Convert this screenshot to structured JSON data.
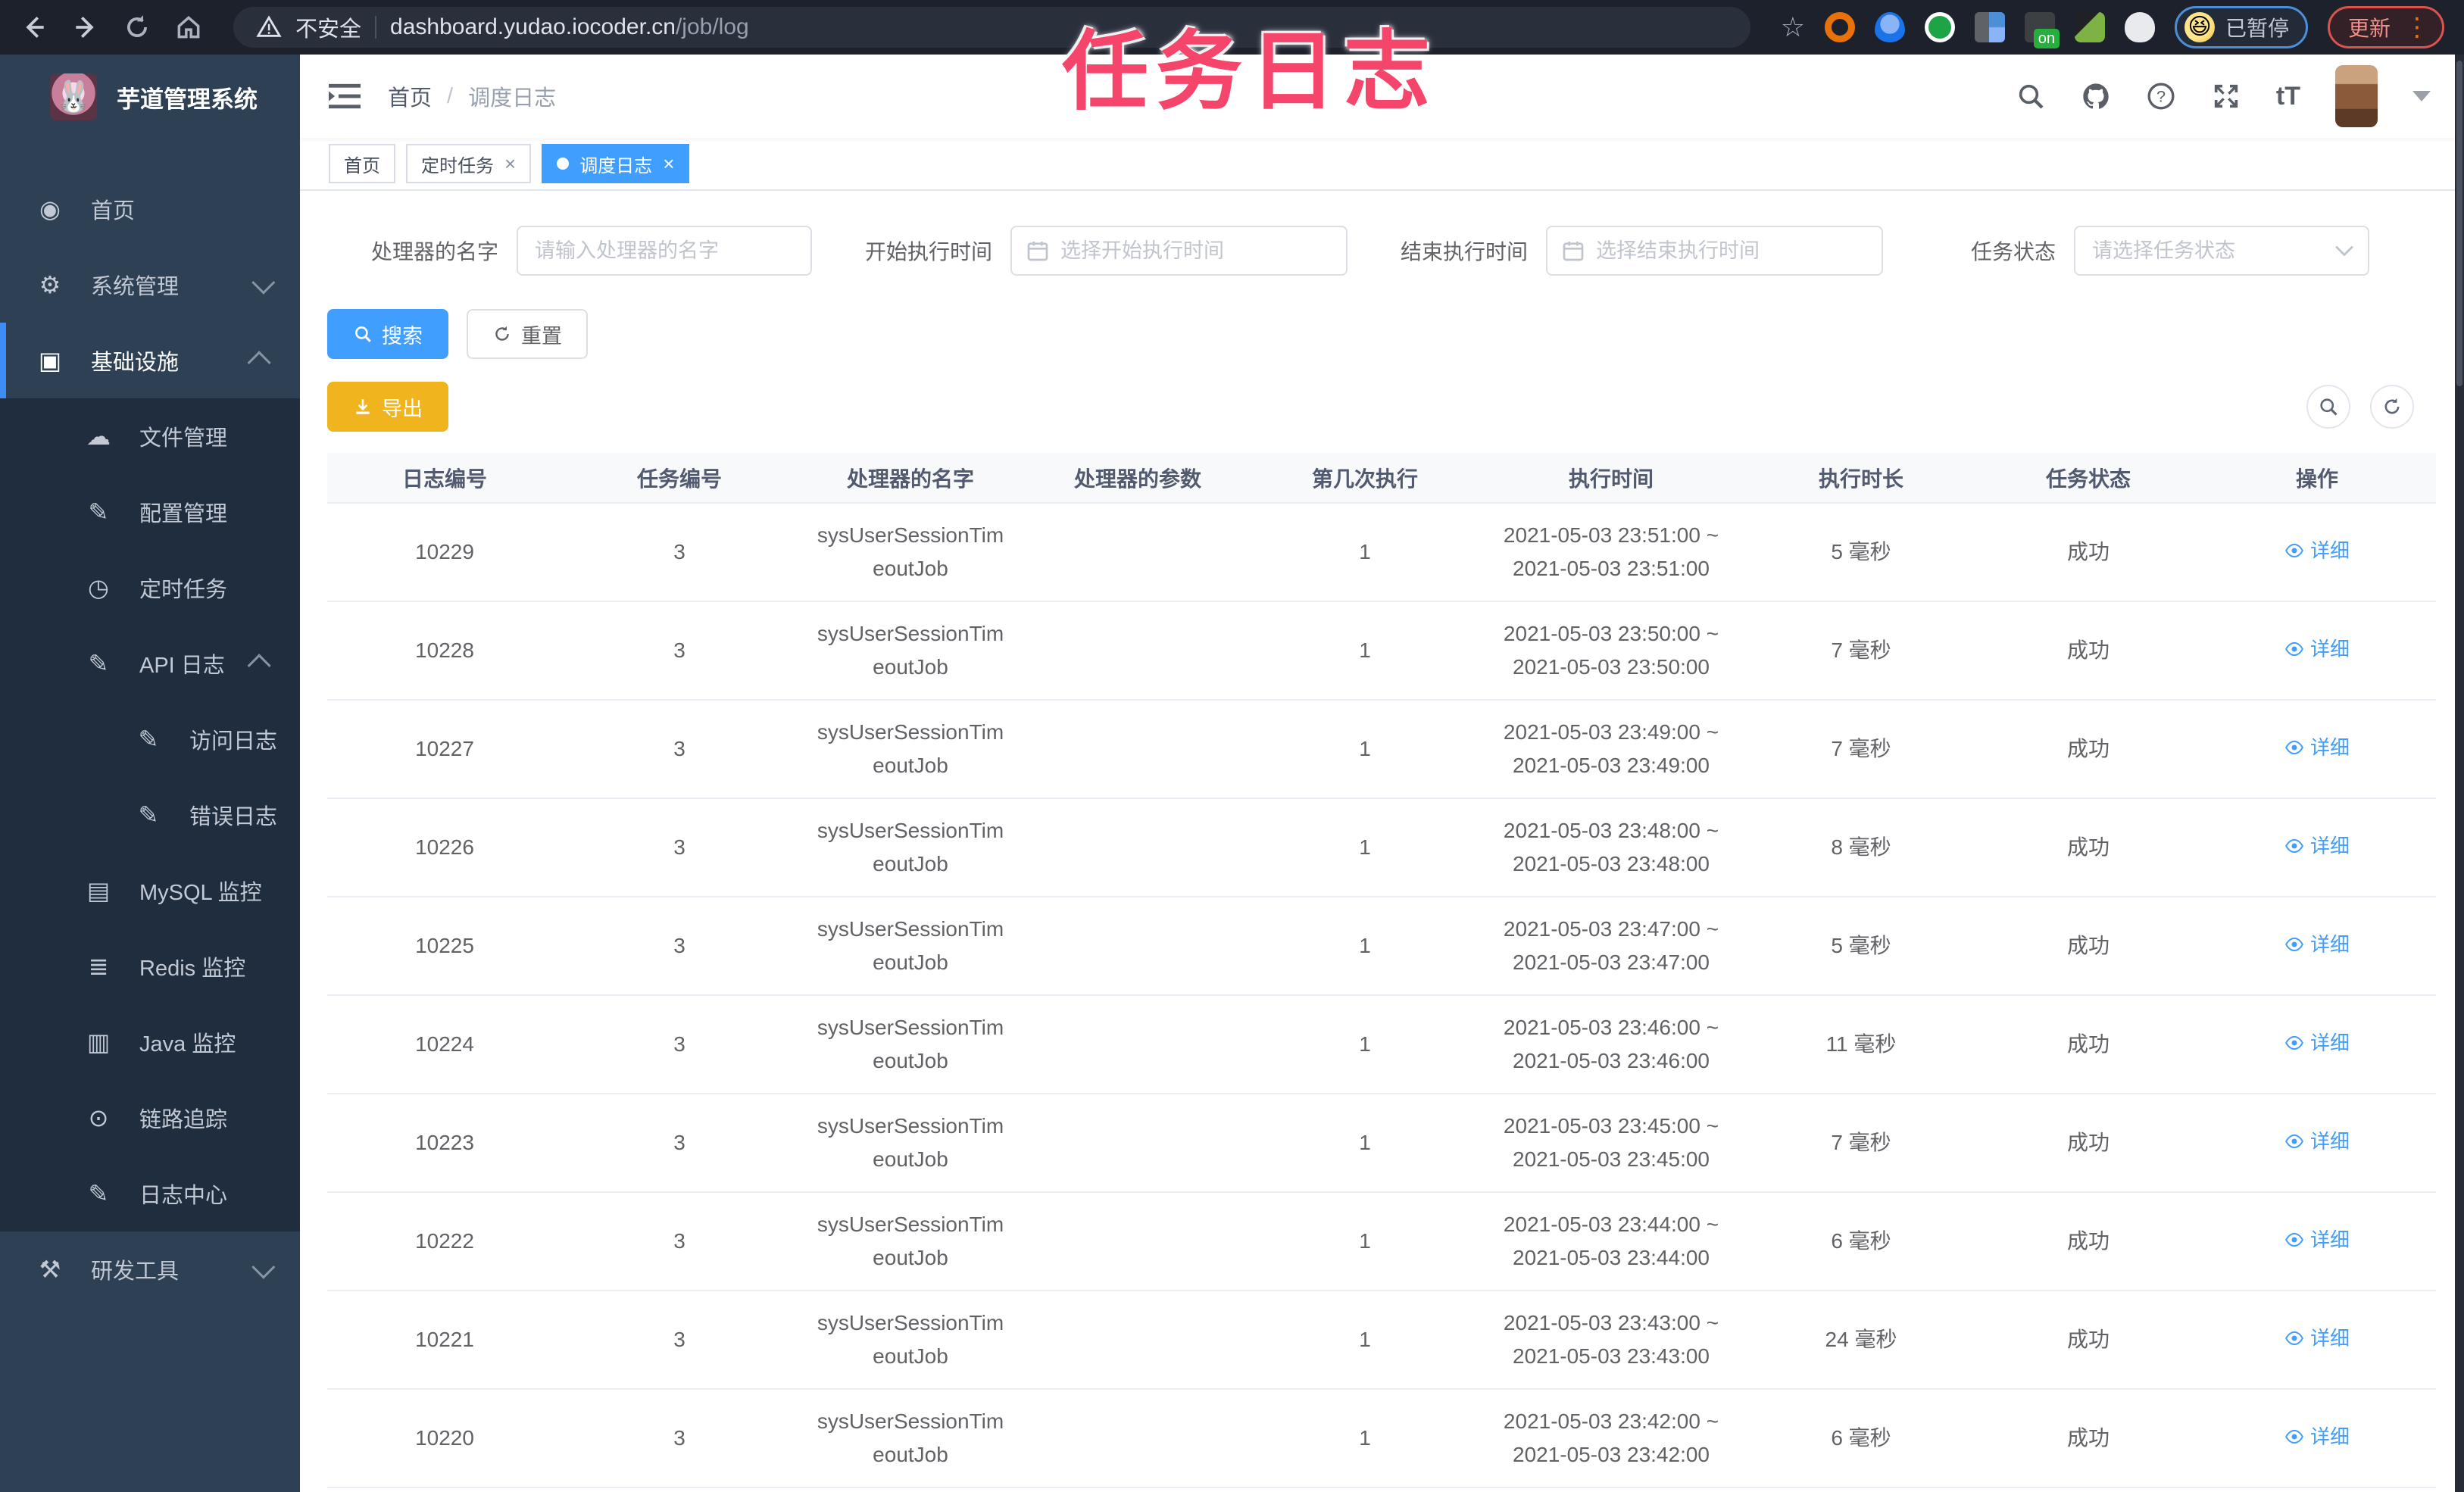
{
  "browser": {
    "security_label": "不安全",
    "url_host": "dashboard.yudao.iocoder.cn",
    "url_path": "/job/log",
    "profile_status": "已暂停",
    "update_label": "更新"
  },
  "overlay_title": "任务日志",
  "sidebar": {
    "app_title": "芋道管理系统",
    "items": [
      {
        "label": "首页",
        "icon": "dashboard-icon",
        "level": 1,
        "arrow": "",
        "active": false,
        "sub": false
      },
      {
        "label": "系统管理",
        "icon": "gear-icon",
        "level": 1,
        "arrow": "down",
        "active": false,
        "sub": false
      },
      {
        "label": "基础设施",
        "icon": "monitor-icon",
        "level": 1,
        "arrow": "up",
        "active": true,
        "sub": false
      },
      {
        "label": "文件管理",
        "icon": "upload-cloud-icon",
        "level": 2,
        "arrow": "",
        "active": false,
        "sub": true
      },
      {
        "label": "配置管理",
        "icon": "edit-icon",
        "level": 2,
        "arrow": "",
        "active": false,
        "sub": true
      },
      {
        "label": "定时任务",
        "icon": "timer-icon",
        "level": 2,
        "arrow": "",
        "active": false,
        "sub": true
      },
      {
        "label": "API 日志",
        "icon": "log-icon",
        "level": 2,
        "arrow": "up",
        "active": false,
        "sub": true
      },
      {
        "label": "访问日志",
        "icon": "log-icon",
        "level": 3,
        "arrow": "",
        "active": false,
        "sub": true
      },
      {
        "label": "错误日志",
        "icon": "log-icon",
        "level": 3,
        "arrow": "",
        "active": false,
        "sub": true
      },
      {
        "label": "MySQL 监控",
        "icon": "database-icon",
        "level": 2,
        "arrow": "",
        "active": false,
        "sub": true
      },
      {
        "label": "Redis 监控",
        "icon": "redis-icon",
        "level": 2,
        "arrow": "",
        "active": false,
        "sub": true
      },
      {
        "label": "Java 监控",
        "icon": "java-icon",
        "level": 2,
        "arrow": "",
        "active": false,
        "sub": true
      },
      {
        "label": "链路追踪",
        "icon": "eye-icon",
        "level": 2,
        "arrow": "",
        "active": false,
        "sub": true
      },
      {
        "label": "日志中心",
        "icon": "log-icon",
        "level": 2,
        "arrow": "",
        "active": false,
        "sub": true
      },
      {
        "label": "研发工具",
        "icon": "toolbox-icon",
        "level": 1,
        "arrow": "down",
        "active": false,
        "sub": false
      }
    ]
  },
  "header": {
    "breadcrumb_home": "首页",
    "breadcrumb_separator": "/",
    "breadcrumb_current": "调度日志"
  },
  "tags": [
    {
      "label": "首页",
      "closable": false,
      "active": false
    },
    {
      "label": "定时任务",
      "closable": true,
      "active": false
    },
    {
      "label": "调度日志",
      "closable": true,
      "active": true
    }
  ],
  "filters": {
    "handler_label": "处理器的名字",
    "handler_placeholder": "请输入处理器的名字",
    "start_label": "开始执行时间",
    "start_placeholder": "选择开始执行时间",
    "end_label": "结束执行时间",
    "end_placeholder": "选择结束执行时间",
    "status_label": "任务状态",
    "status_placeholder": "请选择任务状态",
    "search_label": "搜索",
    "reset_label": "重置",
    "export_label": "导出"
  },
  "table": {
    "columns": [
      "日志编号",
      "任务编号",
      "处理器的名字",
      "处理器的参数",
      "第几次执行",
      "执行时间",
      "执行时长",
      "任务状态",
      "操作"
    ],
    "action_label": "详细",
    "rows": [
      {
        "id": "10229",
        "job_id": "3",
        "handler_line1": "sysUserSessionTim",
        "handler_line2": "eoutJob",
        "param": "",
        "exec_index": "1",
        "time_line1": "2021-05-03 23:51:00 ~",
        "time_line2": "2021-05-03 23:51:00",
        "duration": "5 毫秒",
        "status": "成功"
      },
      {
        "id": "10228",
        "job_id": "3",
        "handler_line1": "sysUserSessionTim",
        "handler_line2": "eoutJob",
        "param": "",
        "exec_index": "1",
        "time_line1": "2021-05-03 23:50:00 ~",
        "time_line2": "2021-05-03 23:50:00",
        "duration": "7 毫秒",
        "status": "成功"
      },
      {
        "id": "10227",
        "job_id": "3",
        "handler_line1": "sysUserSessionTim",
        "handler_line2": "eoutJob",
        "param": "",
        "exec_index": "1",
        "time_line1": "2021-05-03 23:49:00 ~",
        "time_line2": "2021-05-03 23:49:00",
        "duration": "7 毫秒",
        "status": "成功"
      },
      {
        "id": "10226",
        "job_id": "3",
        "handler_line1": "sysUserSessionTim",
        "handler_line2": "eoutJob",
        "param": "",
        "exec_index": "1",
        "time_line1": "2021-05-03 23:48:00 ~",
        "time_line2": "2021-05-03 23:48:00",
        "duration": "8 毫秒",
        "status": "成功"
      },
      {
        "id": "10225",
        "job_id": "3",
        "handler_line1": "sysUserSessionTim",
        "handler_line2": "eoutJob",
        "param": "",
        "exec_index": "1",
        "time_line1": "2021-05-03 23:47:00 ~",
        "time_line2": "2021-05-03 23:47:00",
        "duration": "5 毫秒",
        "status": "成功"
      },
      {
        "id": "10224",
        "job_id": "3",
        "handler_line1": "sysUserSessionTim",
        "handler_line2": "eoutJob",
        "param": "",
        "exec_index": "1",
        "time_line1": "2021-05-03 23:46:00 ~",
        "time_line2": "2021-05-03 23:46:00",
        "duration": "11 毫秒",
        "status": "成功"
      },
      {
        "id": "10223",
        "job_id": "3",
        "handler_line1": "sysUserSessionTim",
        "handler_line2": "eoutJob",
        "param": "",
        "exec_index": "1",
        "time_line1": "2021-05-03 23:45:00 ~",
        "time_line2": "2021-05-03 23:45:00",
        "duration": "7 毫秒",
        "status": "成功"
      },
      {
        "id": "10222",
        "job_id": "3",
        "handler_line1": "sysUserSessionTim",
        "handler_line2": "eoutJob",
        "param": "",
        "exec_index": "1",
        "time_line1": "2021-05-03 23:44:00 ~",
        "time_line2": "2021-05-03 23:44:00",
        "duration": "6 毫秒",
        "status": "成功"
      },
      {
        "id": "10221",
        "job_id": "3",
        "handler_line1": "sysUserSessionTim",
        "handler_line2": "eoutJob",
        "param": "",
        "exec_index": "1",
        "time_line1": "2021-05-03 23:43:00 ~",
        "time_line2": "2021-05-03 23:43:00",
        "duration": "24 毫秒",
        "status": "成功"
      },
      {
        "id": "10220",
        "job_id": "3",
        "handler_line1": "sysUserSessionTim",
        "handler_line2": "eoutJob",
        "param": "",
        "exec_index": "1",
        "time_line1": "2021-05-03 23:42:00 ~",
        "time_line2": "2021-05-03 23:42:00",
        "duration": "6 毫秒",
        "status": "成功"
      }
    ]
  },
  "colors": {
    "accent_blue": "#409eff",
    "warning_yellow": "#f0b41e",
    "sidebar_bg": "#2e4054",
    "submenu_bg": "#1f2d3f",
    "chrome_bg": "#1d212c",
    "overlay_pink": "#f5456b"
  }
}
